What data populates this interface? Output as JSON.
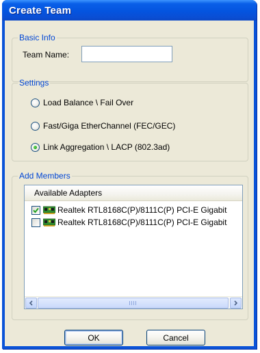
{
  "window": {
    "title": "Create Team"
  },
  "basic_info": {
    "legend": "Basic Info",
    "team_name_label": "Team Name:",
    "team_name_value": ""
  },
  "settings": {
    "legend": "Settings",
    "options": [
      {
        "label": "Load Balance \\ Fail Over",
        "selected": false
      },
      {
        "label": "Fast/Giga EtherChannel (FEC/GEC)",
        "selected": false
      },
      {
        "label": "Link Aggregation \\ LACP (802.3ad)",
        "selected": true
      }
    ]
  },
  "members": {
    "legend": "Add Members",
    "list_header": "Available Adapters",
    "adapters": [
      {
        "label": "Realtek RTL8168C(P)/8111C(P) PCI-E Gigabit",
        "checked": true,
        "icon": "network-adapter-icon"
      },
      {
        "label": "Realtek RTL8168C(P)/8111C(P) PCI-E Gigabit",
        "checked": false,
        "icon": "network-adapter-icon"
      }
    ]
  },
  "buttons": {
    "ok": "OK",
    "cancel": "Cancel"
  },
  "colors": {
    "titlebar": "#0a53d8",
    "dialog_background": "#ece9d8",
    "groupbox_legend": "#0046d5"
  }
}
